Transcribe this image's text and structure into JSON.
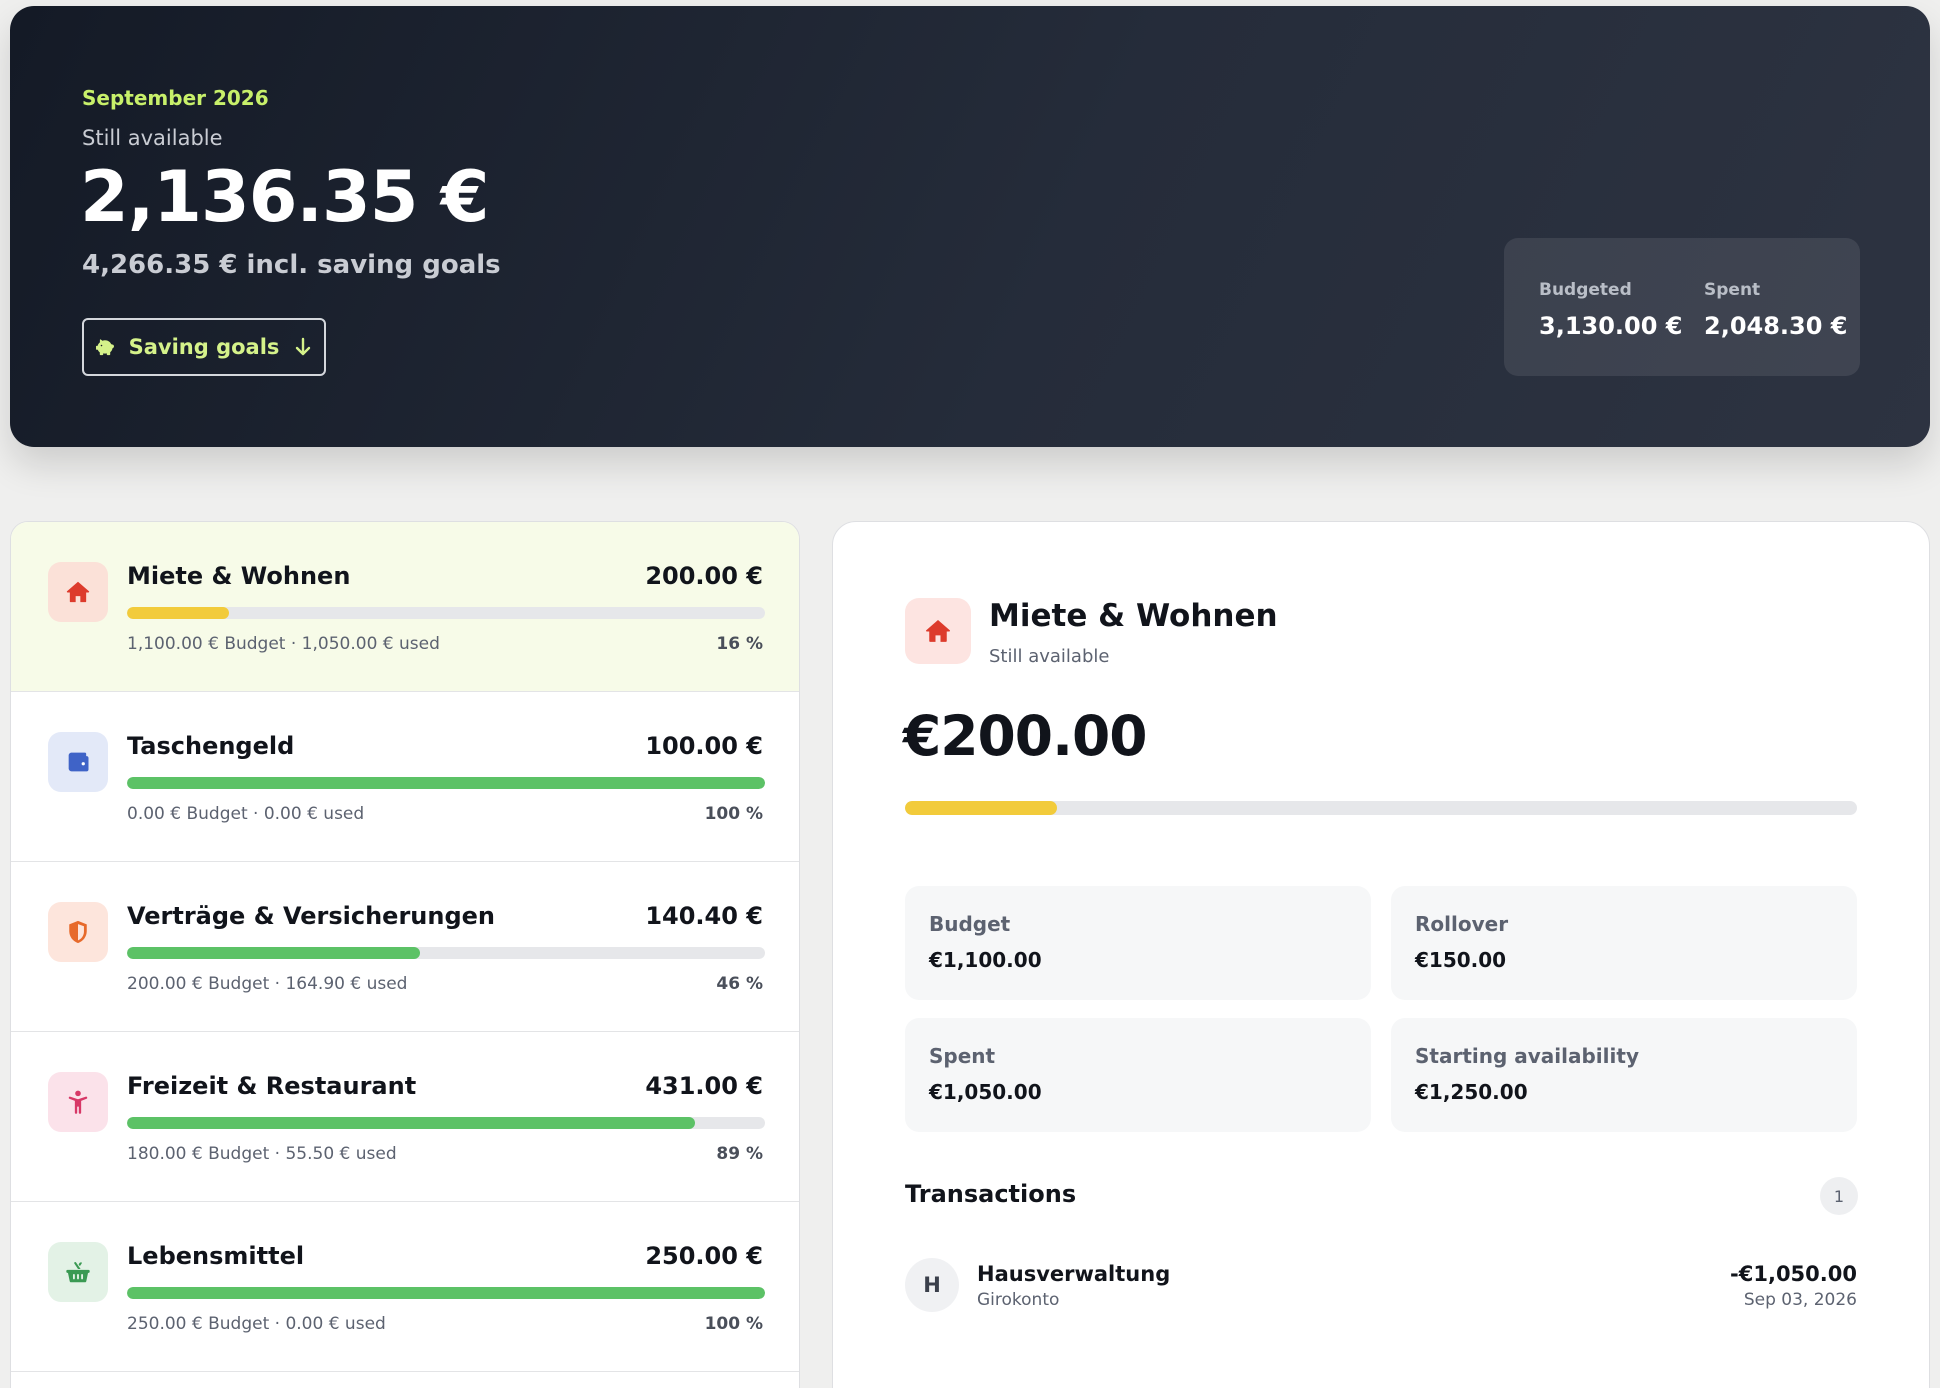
{
  "colors": {
    "accent_lime": "#c8f06a",
    "progress_yellow": "#f2cb3b",
    "progress_green": "#5cc266",
    "selected_row": "#f7fbe8"
  },
  "header": {
    "month": "September 2026",
    "subtitle": "Still available",
    "amount": "2,136.35 €",
    "incl_savings": "4,266.35 € incl. saving goals",
    "saving_goals_button": "Saving goals",
    "budgeted_label": "Budgeted",
    "budgeted_value": "3,130.00 €",
    "spent_label": "Spent",
    "spent_value": "2,048.30 €"
  },
  "categories": [
    {
      "name": "Miete & Wohnen",
      "amount": "200.00 €",
      "meta": "1,100.00 € Budget · 1,050.00 € used",
      "percent": "16 %",
      "progress": 0.16,
      "icon": "house-icon",
      "bar_color": "#f2cb3b",
      "icon_bg": "#fbe1d8",
      "icon_color": "#dd3b2c",
      "selected": true
    },
    {
      "name": "Taschengeld",
      "amount": "100.00 €",
      "meta": "0.00 € Budget · 0.00 € used",
      "percent": "100 %",
      "progress": 1.0,
      "icon": "wallet-icon",
      "bar_color": "#5cc266",
      "icon_bg": "#e3e9f8",
      "icon_color": "#3f63c7",
      "selected": false
    },
    {
      "name": "Verträge & Versicherungen",
      "amount": "140.40 €",
      "meta": "200.00 € Budget · 164.90 € used",
      "percent": "46 %",
      "progress": 0.46,
      "icon": "shield-icon",
      "bar_color": "#5cc266",
      "icon_bg": "#fde5dc",
      "icon_color": "#e76a2b",
      "selected": false
    },
    {
      "name": "Freizeit & Restaurant",
      "amount": "431.00 €",
      "meta": "180.00 € Budget · 55.50 € used",
      "percent": "89 %",
      "progress": 0.89,
      "icon": "person-icon",
      "bar_color": "#5cc266",
      "icon_bg": "#fbe2ea",
      "icon_color": "#d73867",
      "selected": false
    },
    {
      "name": "Lebensmittel",
      "amount": "250.00 €",
      "meta": "250.00 € Budget · 0.00 € used",
      "percent": "100 %",
      "progress": 1.0,
      "icon": "basket-icon",
      "bar_color": "#5cc266",
      "icon_bg": "#e3f2e6",
      "icon_color": "#3a9a53",
      "selected": false
    }
  ],
  "detail": {
    "title": "Miete & Wohnen",
    "subtitle": "Still available",
    "icon": "house-icon",
    "amount": "€200.00",
    "progress": 0.16,
    "tiles": [
      {
        "label": "Budget",
        "value": "€1,100.00"
      },
      {
        "label": "Rollover",
        "value": "€150.00"
      },
      {
        "label": "Spent",
        "value": "€1,050.00"
      },
      {
        "label": "Starting availability",
        "value": "€1,250.00"
      }
    ],
    "transactions_label": "Transactions",
    "transactions_count": "1",
    "transactions": [
      {
        "initial": "H",
        "name": "Hausverwaltung",
        "account": "Girokonto",
        "amount": "-€1,050.00",
        "date": "Sep 03, 2026"
      }
    ]
  }
}
